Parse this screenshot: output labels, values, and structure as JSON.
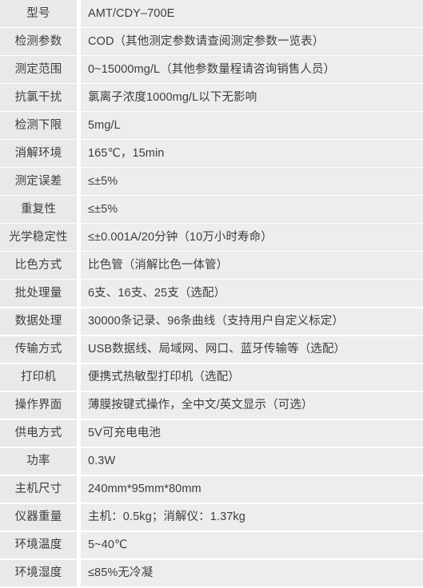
{
  "table": {
    "name": "product-specification-table",
    "row_count": 21,
    "colors": {
      "page_background": "#ffffff",
      "label_cell_background": "#e9e9e9",
      "value_cell_background": "#ededed",
      "text": "#3d3d3d",
      "separator": "#ffffff"
    },
    "rows": [
      {
        "label": "型号",
        "value": "AMT/CDY–700E"
      },
      {
        "label": "检测参数",
        "value": "COD（其他测定参数请查阅测定参数一览表）"
      },
      {
        "label": "测定范围",
        "value": "0~15000mg/L（其他参数量程请咨询销售人员）"
      },
      {
        "label": "抗氯干扰",
        "value": "氯离子浓度1000mg/L以下无影响"
      },
      {
        "label": "检测下限",
        "value": "5mg/L"
      },
      {
        "label": "消解环境",
        "value": "165℃，15min"
      },
      {
        "label": "测定误差",
        "value": "≤±5%"
      },
      {
        "label": "重复性",
        "value": "≤±5%"
      },
      {
        "label": "光学稳定性",
        "value": "≤±0.001A/20分钟（10万小时寿命）"
      },
      {
        "label": "比色方式",
        "value": "比色管（消解比色一体管）"
      },
      {
        "label": "批处理量",
        "value": "6支、16支、25支（选配）"
      },
      {
        "label": "数据处理",
        "value": "30000条记录、96条曲线（支持用户自定义标定）"
      },
      {
        "label": "传输方式",
        "value": "USB数据线、局域网、网口、蓝牙传输等（选配）"
      },
      {
        "label": "打印机",
        "value": "便携式热敏型打印机（选配）"
      },
      {
        "label": "操作界面",
        "value": "薄膜按键式操作，全中文/英文显示（可选）"
      },
      {
        "label": "供电方式",
        "value": "5V可充电电池"
      },
      {
        "label": "功率",
        "value": "0.3W"
      },
      {
        "label": "主机尺寸",
        "value": "240mm*95mm*80mm"
      },
      {
        "label": "仪器重量",
        "value": "主机：0.5kg；消解仪：1.37kg"
      },
      {
        "label": "环境温度",
        "value": "5~40℃"
      },
      {
        "label": "环境湿度",
        "value": "≤85%无冷凝"
      }
    ]
  }
}
